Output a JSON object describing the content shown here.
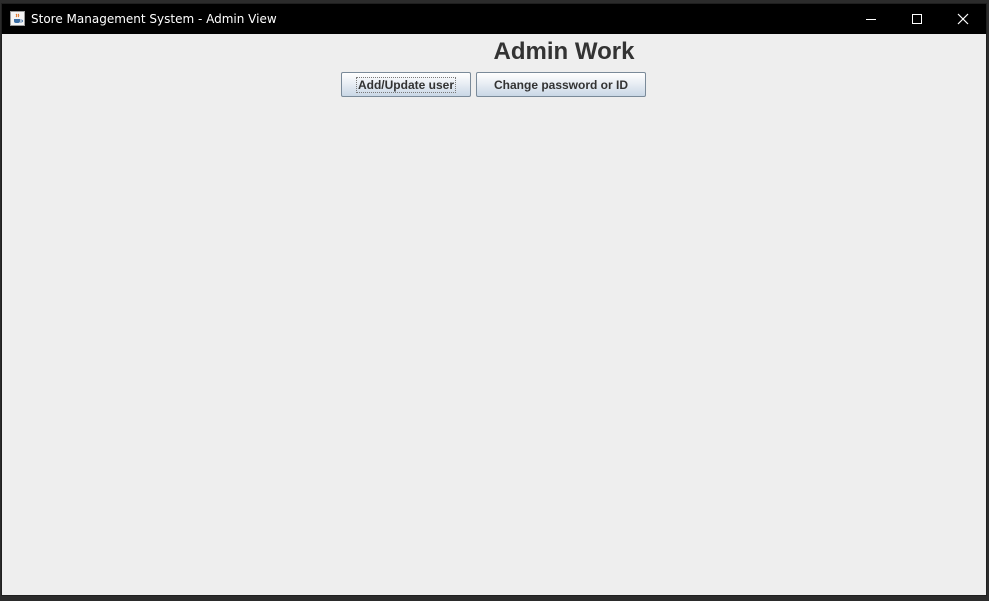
{
  "window": {
    "title": "Store Management System - Admin View",
    "controls": {
      "minimize_icon": "minimize-icon",
      "maximize_icon": "maximize-icon",
      "close_icon": "close-icon"
    },
    "app_icon": "java-cup-icon"
  },
  "main": {
    "heading": "Admin Work",
    "buttons": {
      "add_update_user": "Add/Update user",
      "change_password_or_id": "Change password or ID"
    }
  },
  "colors": {
    "titlebar": "#000000",
    "background": "#eeeeee",
    "button_border": "#7a8a99",
    "text": "#333333"
  }
}
